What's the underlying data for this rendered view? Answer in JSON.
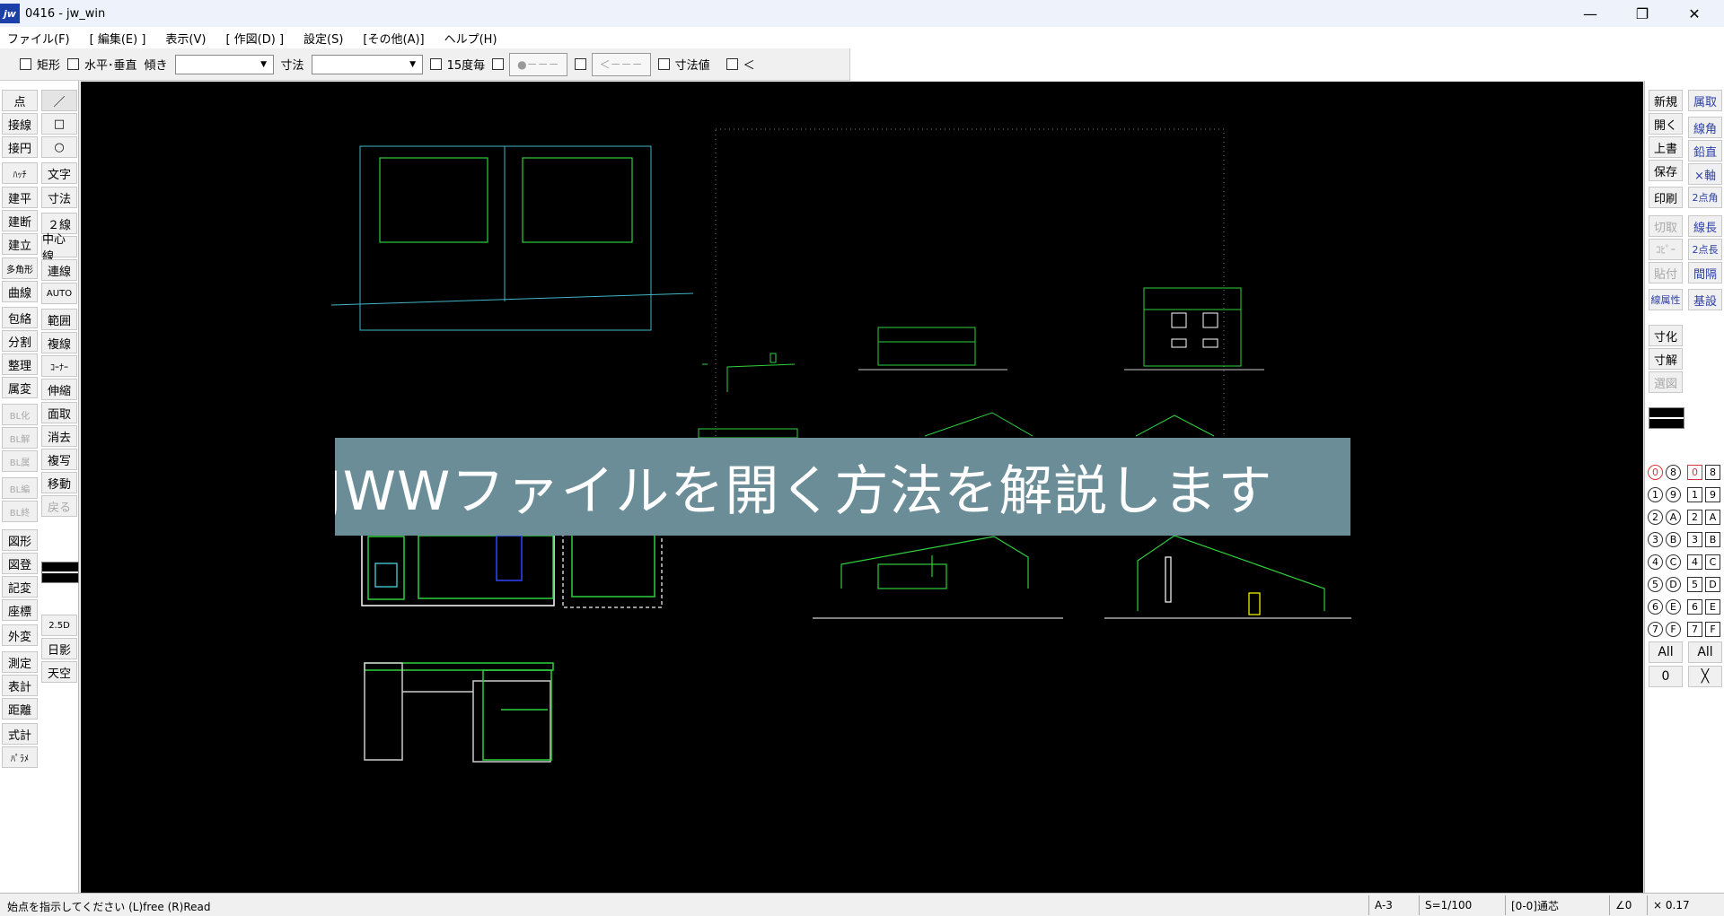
{
  "window": {
    "title": "0416 - jw_win",
    "app_icon_text": "jw",
    "minimize": "—",
    "restore": "❐",
    "close": "✕"
  },
  "menu": [
    "ファイル(F)",
    "[ 編集(E) ]",
    "表示(V)",
    "[ 作図(D) ]",
    "設定(S)",
    "[その他(A)]",
    "ヘルプ(H)"
  ],
  "options": {
    "rect": "矩形",
    "hv": "水平･垂直",
    "tilt": "傾き",
    "dim": "寸法",
    "deg15": "15度毎",
    "btn_circle": "●－－－",
    "btn_arrow": "＜－－－",
    "dim_value": "寸法値",
    "lt": "＜"
  },
  "left_tools": {
    "col1": [
      {
        "label": "点",
        "dis": false
      },
      {
        "label": "接線",
        "dis": false
      },
      {
        "label": "接円",
        "dis": false
      },
      {
        "label": "ﾊｯﾁ",
        "dis": false
      },
      {
        "label": "建平",
        "dis": false
      },
      {
        "label": "建断",
        "dis": false
      },
      {
        "label": "建立",
        "dis": false
      },
      {
        "label": "多角形",
        "dis": false
      },
      {
        "label": "曲線",
        "dis": false
      },
      {
        "label": "包絡",
        "dis": false
      },
      {
        "label": "分割",
        "dis": false
      },
      {
        "label": "整理",
        "dis": false
      },
      {
        "label": "属変",
        "dis": false
      },
      {
        "label": "BL化",
        "dis": true
      },
      {
        "label": "BL解",
        "dis": true
      },
      {
        "label": "BL属",
        "dis": true
      },
      {
        "label": "BL編",
        "dis": true
      },
      {
        "label": "BL終",
        "dis": true
      },
      {
        "label": "図形",
        "dis": false
      },
      {
        "label": "図登",
        "dis": false
      },
      {
        "label": "記変",
        "dis": false
      },
      {
        "label": "座標",
        "dis": false
      },
      {
        "label": "外変",
        "dis": false
      },
      {
        "label": "測定",
        "dis": false
      },
      {
        "label": "表計",
        "dis": false
      },
      {
        "label": "距離",
        "dis": false
      },
      {
        "label": "式計",
        "dis": false
      },
      {
        "label": "ﾊﾟﾗﾒ",
        "dis": false
      }
    ],
    "col2": [
      {
        "label": "／",
        "dis": false
      },
      {
        "label": "□",
        "dis": false
      },
      {
        "label": "○",
        "dis": false
      },
      {
        "label": "文字",
        "dis": false
      },
      {
        "label": "寸法",
        "dis": false
      },
      {
        "label": "２線",
        "dis": false
      },
      {
        "label": "中心線",
        "dis": false
      },
      {
        "label": "連線",
        "dis": false
      },
      {
        "label": "AUTO",
        "dis": false
      },
      {
        "label": "範囲",
        "dis": false
      },
      {
        "label": "複線",
        "dis": false
      },
      {
        "label": "ｺｰﾅｰ",
        "dis": false
      },
      {
        "label": "伸縮",
        "dis": false
      },
      {
        "label": "面取",
        "dis": false
      },
      {
        "label": "消去",
        "dis": false
      },
      {
        "label": "複写",
        "dis": false
      },
      {
        "label": "移動",
        "dis": false
      },
      {
        "label": "戻る",
        "dis": true
      },
      {
        "label": "2.5D",
        "dis": false
      },
      {
        "label": "日影",
        "dis": false
      },
      {
        "label": "天空",
        "dis": false
      }
    ]
  },
  "right_tools": {
    "col1": [
      {
        "label": "新規",
        "cls": ""
      },
      {
        "label": "開く",
        "cls": ""
      },
      {
        "label": "上書",
        "cls": ""
      },
      {
        "label": "保存",
        "cls": ""
      },
      {
        "label": "印刷",
        "cls": ""
      },
      {
        "label": "切取",
        "cls": "dis"
      },
      {
        "label": "ｺﾋﾟｰ",
        "cls": "dis"
      },
      {
        "label": "貼付",
        "cls": "dis"
      },
      {
        "label": "線属性",
        "cls": "blue"
      },
      {
        "label": "寸化",
        "cls": ""
      },
      {
        "label": "寸解",
        "cls": ""
      },
      {
        "label": "選図",
        "cls": "dis"
      }
    ],
    "col2": [
      {
        "label": "属取",
        "cls": "blue"
      },
      {
        "label": "線角",
        "cls": "blue"
      },
      {
        "label": "鉛直",
        "cls": "blue"
      },
      {
        "label": "×軸",
        "cls": "blue"
      },
      {
        "label": "2点角",
        "cls": "blue"
      },
      {
        "label": "線長",
        "cls": "blue"
      },
      {
        "label": "2点長",
        "cls": "blue"
      },
      {
        "label": "間隔",
        "cls": "blue"
      },
      {
        "label": "基設",
        "cls": "blue"
      }
    ],
    "layer_groups": [
      "0",
      "1",
      "2",
      "3",
      "4",
      "5",
      "6",
      "7"
    ],
    "layer_groups_b": [
      "8",
      "9",
      "A",
      "B",
      "C",
      "D",
      "E",
      "F"
    ],
    "layers": [
      "0",
      "1",
      "2",
      "3",
      "4",
      "5",
      "6",
      "7"
    ],
    "layers_b": [
      "8",
      "9",
      "A",
      "B",
      "C",
      "D",
      "E",
      "F"
    ],
    "all1": "All",
    "all2": "All",
    "zero": "0",
    "cross": "╳"
  },
  "banner": "JWWファイルを開く方法を解説します",
  "status": {
    "message": "始点を指示してください (L)free (R)Read",
    "paper": "A-3",
    "scale": "S=1/100",
    "layer": "[0-0]通芯",
    "angle": "∠0",
    "zoom": "× 0.17"
  }
}
